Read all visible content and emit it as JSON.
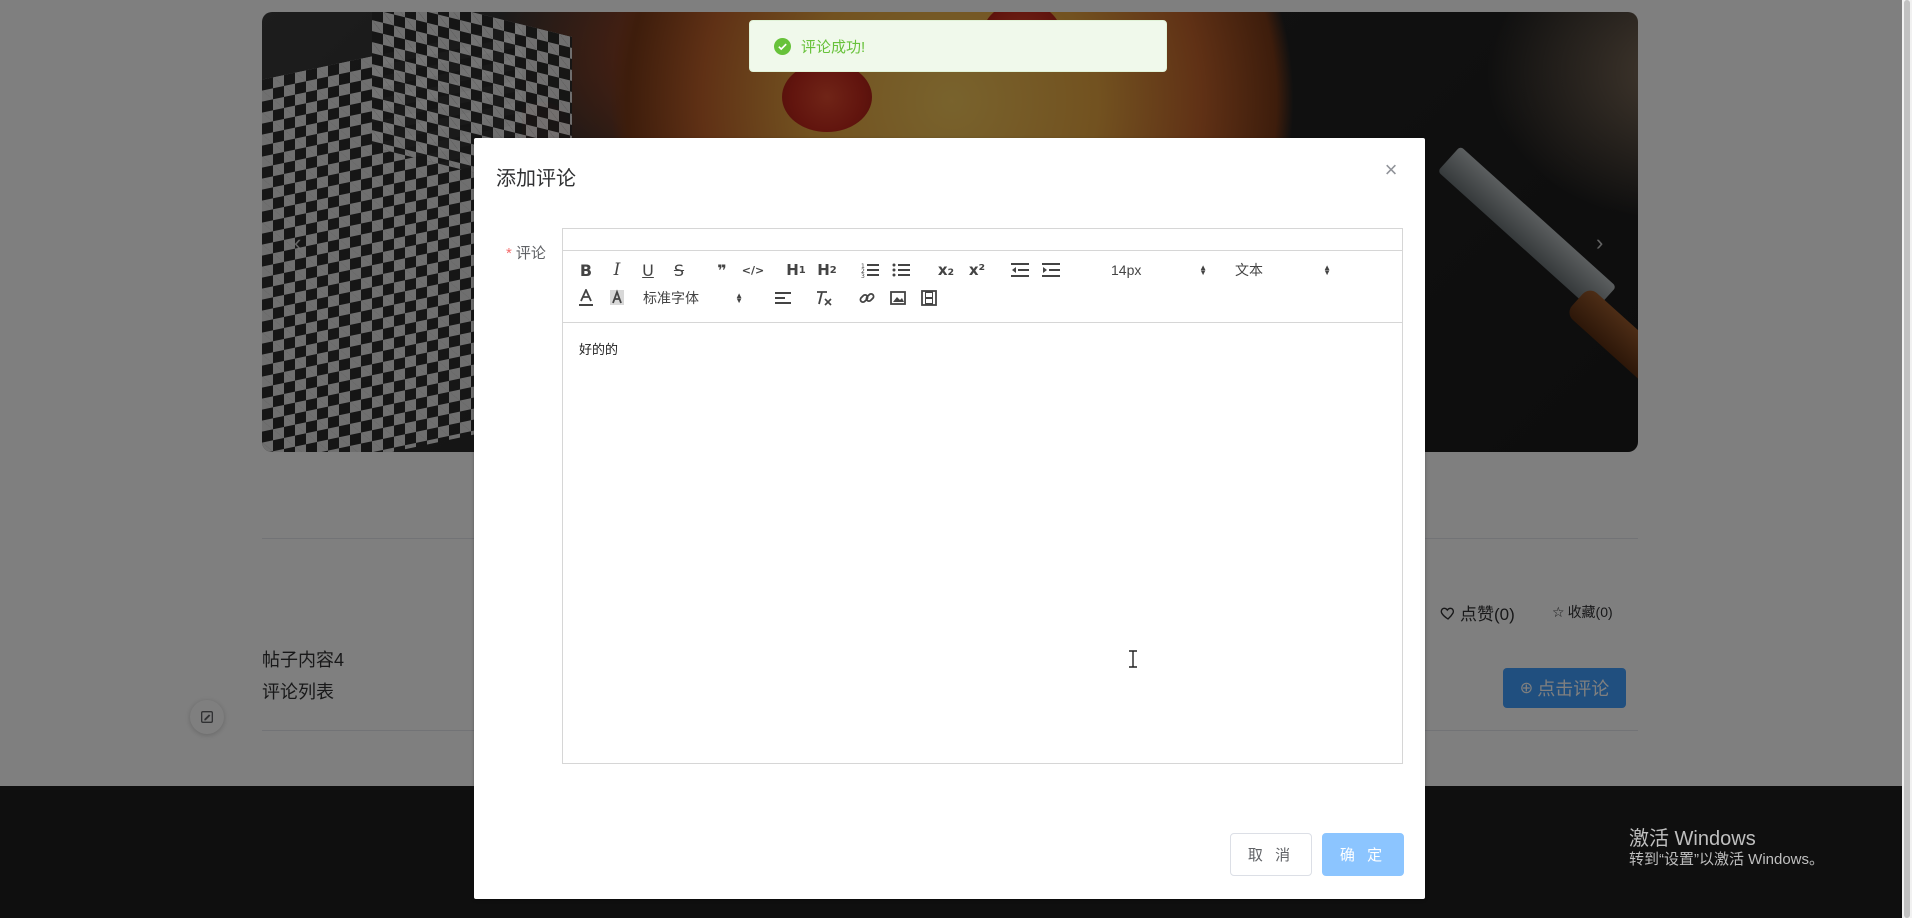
{
  "toast": {
    "message": "评论成功!",
    "color": "#67c23a"
  },
  "dialog": {
    "title": "添加评论",
    "field_label": "评论",
    "editor": {
      "toolbar": {
        "bold": "B",
        "italic": "I",
        "underline": "U",
        "strike": "S",
        "quote": "❞",
        "code": "</>",
        "h1": "H",
        "h1_sub": "1",
        "h2": "H",
        "h2_sub": "2",
        "ordered_list": "≡",
        "bullet_list": "☰",
        "subscript": "x₂",
        "superscript": "x²",
        "outdent": "⇤",
        "indent": "⇥",
        "font_size": "14px",
        "header_type": "文本",
        "font_family": "标准字体"
      },
      "content": "好的的"
    },
    "cancel_label": "取 消",
    "ok_label": "确 定"
  },
  "page": {
    "post_title": "帖子内容4",
    "comment_list_label": "评论列表",
    "like_label": "点赞(0)",
    "favorite_label": "收藏(0)",
    "comment_button_label": "点击评论"
  },
  "os_watermark": {
    "title": "激活 Windows",
    "subtitle": "转到“设置”以激活 Windows。"
  },
  "colors": {
    "primary": "#409eff",
    "primary_disabled": "#8cc5ff",
    "success": "#67c23a",
    "required": "#f56c6c"
  }
}
